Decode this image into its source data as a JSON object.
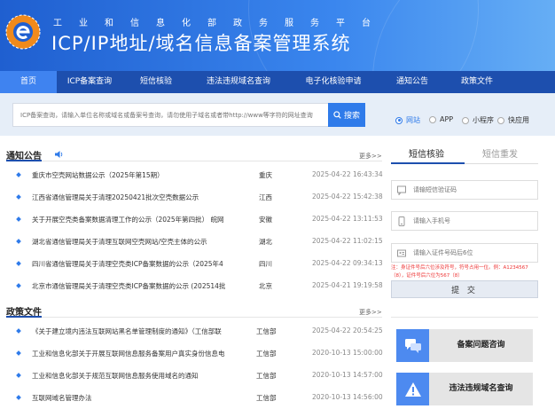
{
  "header": {
    "subtitle": "工业和信息化部政务服务平台",
    "title": "ICP/IP地址/域名信息备案管理系统"
  },
  "nav": [
    {
      "label": "首页",
      "active": true
    },
    {
      "label": "ICP备案查询"
    },
    {
      "label": "短信核验"
    },
    {
      "label": "违法违规域名查询"
    },
    {
      "label": "电子化核验申请"
    },
    {
      "label": "通知公告"
    },
    {
      "label": "政策文件"
    }
  ],
  "search": {
    "placeholder": "ICP备案查询，请输入单位名称或域名或备案号查询，请勿使用子域名或者带http://www等字符的网址查询",
    "button_label": "搜索",
    "options": [
      {
        "label": "网站",
        "checked": true
      },
      {
        "label": "APP"
      },
      {
        "label": "小程序"
      },
      {
        "label": "快应用"
      }
    ]
  },
  "notices": {
    "title": "通知公告",
    "more": "更多>>",
    "items": [
      {
        "title": "重庆市空壳网站数据公示（2025年第15期）",
        "region": "重庆",
        "date": "2025-04-22 16:43:34"
      },
      {
        "title": "江西省通信管理局关于清理20250421批次空壳数据公示",
        "region": "江西",
        "date": "2025-04-22 15:42:38"
      },
      {
        "title": "关于开展空壳类备案数据清理工作的公示（2025年第四批） 皖网",
        "region": "安徽",
        "date": "2025-04-22 13:11:53"
      },
      {
        "title": "湖北省通信管理局关于清理互联网空壳网站/空壳主体的公示",
        "region": "湖北",
        "date": "2025-04-22 11:02:15"
      },
      {
        "title": "四川省通信管理局关于清理空壳类ICP备案数据的公示（2025年4",
        "region": "四川",
        "date": "2025-04-22 09:34:13"
      },
      {
        "title": "北京市通信管理局关于清理空壳类ICP备案数据的公示 (202514批",
        "region": "北京",
        "date": "2025-04-21 19:19:58"
      }
    ]
  },
  "policies": {
    "title": "政策文件",
    "more": "更多>>",
    "items": [
      {
        "title": "《关于建立境内违法互联网站黑名单管理制度的通知》（工信部联",
        "region": "工信部",
        "date": "2025-04-22 20:54:25"
      },
      {
        "title": "工业和信息化部关于开展互联网信息服务备案用户真实身份信息电",
        "region": "工信部",
        "date": "2020-10-13 15:00:00"
      },
      {
        "title": "工业和信息化部关于规范互联网信息服务使用域名的通知",
        "region": "工信部",
        "date": "2020-10-13 14:57:00"
      },
      {
        "title": "互联网域名管理办法",
        "region": "工信部",
        "date": "2020-10-13 14:56:00"
      }
    ]
  },
  "sms": {
    "tabs": [
      "短信核验",
      "短信重发"
    ],
    "code_placeholder": "请输短信验证码",
    "phone_placeholder": "请输入手机号",
    "id_placeholder": "请输入证件号码后6位",
    "note": "注：身证件号后六位涉及符号，符号占用一位。例：A1234567（8），证件号后六位为567（8）",
    "submit": "提 交"
  },
  "cards": [
    {
      "label": "备案问题咨询",
      "icon": "chat-icon"
    },
    {
      "label": "违法违规域名查询",
      "icon": "warning-icon"
    }
  ],
  "colors": {
    "header": "#2a70e0",
    "nav": "#1d4fae",
    "nav_active": "#3f83f0",
    "accent": "#2f7bea",
    "note": "#e33"
  }
}
